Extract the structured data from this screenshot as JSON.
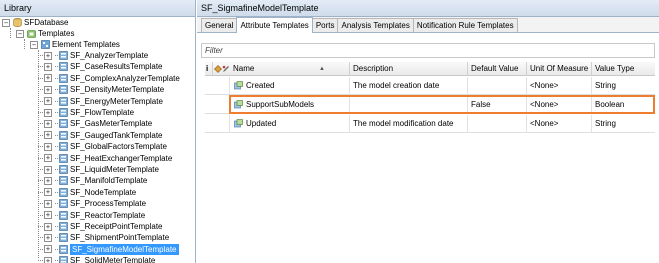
{
  "library": {
    "header": "Library",
    "root": "SFDatabase",
    "templates": "Templates",
    "element_templates": "Element Templates",
    "items": [
      "SF_AnalyzerTemplate",
      "SF_CaseResultsTemplate",
      "SF_ComplexAnalyzerTemplate",
      "SF_DensityMeterTemplate",
      "SF_EnergyMeterTemplate",
      "SF_FlowTemplate",
      "SF_GasMeterTemplate",
      "SF_GaugedTankTemplate",
      "SF_GlobalFactorsTemplate",
      "SF_HeatExchangerTemplate",
      "SF_LiquidMeterTemplate",
      "SF_ManifoldTemplate",
      "SF_NodeTemplate",
      "SF_ProcessTemplate",
      "SF_ReactorTemplate",
      "SF_ReceiptPointTemplate",
      "SF_ShipmentPointTemplate",
      "SF_SigmafineModelTemplate",
      "SF_SolidMeterTemplate"
    ],
    "selected_index": 17
  },
  "detail": {
    "title": "SF_SigmafineModelTemplate",
    "tabs": [
      "General",
      "Attribute Templates",
      "Ports",
      "Analysis Templates",
      "Notification Rule Templates"
    ],
    "active_tab": 1,
    "filter_placeholder": "Filter",
    "columns": {
      "name": "Name",
      "description": "Description",
      "default_value": "Default Value",
      "unit_of_measure": "Unit Of Measure",
      "value_type": "Value Type"
    },
    "rows": [
      {
        "name": "Created",
        "description": "The model creation date",
        "default_value": "",
        "uom": "<None>",
        "value_type": "String"
      },
      {
        "name": "SupportSubModels",
        "description": "",
        "default_value": "False",
        "uom": "<None>",
        "value_type": "Boolean"
      },
      {
        "name": "Updated",
        "description": "The model modification date",
        "default_value": "",
        "uom": "<None>",
        "value_type": "String"
      }
    ],
    "highlighted_row": 1
  },
  "colors": {
    "highlight_border": "#ee7d2f",
    "selection": "#3399ff",
    "header_gradient_top": "#e3ecf6"
  }
}
